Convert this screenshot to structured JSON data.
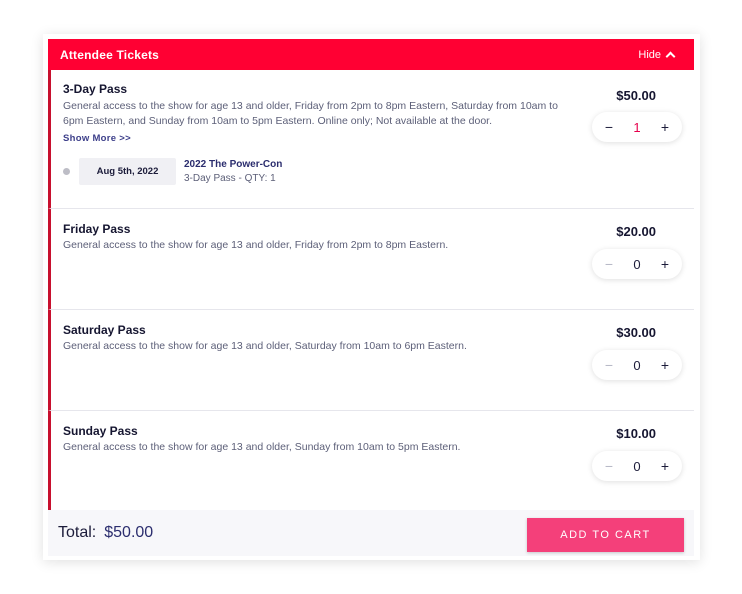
{
  "header": {
    "title": "Attendee Tickets",
    "hide_label": "Hide"
  },
  "tickets": [
    {
      "name": "3-Day Pass",
      "description": "General access to the show for age 13 and older, Friday from 2pm to 8pm Eastern, Saturday from 10am to 6pm Eastern, and Sunday from 10am to 5pm Eastern. Online only; Not available at the door.",
      "show_more": "Show More >>",
      "price": "$50.00",
      "qty": "1",
      "event": {
        "date": "Aug 5th, 2022",
        "title": "2022 The Power-Con",
        "subtitle": "3-Day Pass - QTY: 1"
      }
    },
    {
      "name": "Friday Pass",
      "description": "General access to the show for age 13 and older, Friday from 2pm to 8pm Eastern.",
      "price": "$20.00",
      "qty": "0"
    },
    {
      "name": "Saturday Pass",
      "description": "General access to the show for age 13 and older, Saturday from 10am to 6pm Eastern.",
      "price": "$30.00",
      "qty": "0"
    },
    {
      "name": "Sunday Pass",
      "description": "General access to the show for age 13 and older, Sunday from 10am to 5pm Eastern.",
      "price": "$10.00",
      "qty": "0"
    }
  ],
  "stepper": {
    "minus": "−",
    "plus": "+"
  },
  "footer": {
    "total_label": "Total:",
    "total_value": "$50.00",
    "add_to_cart": "ADD TO CART"
  },
  "colors": {
    "header": "#ff0033",
    "accent_border": "#c8102e",
    "cart_button": "#f4407a"
  }
}
